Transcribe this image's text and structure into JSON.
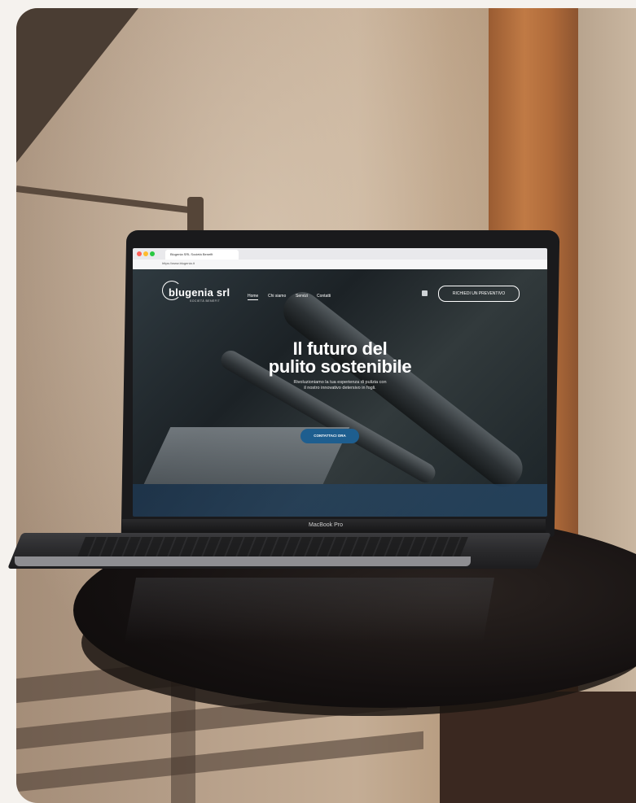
{
  "browser": {
    "tab_title": "Blugenia SRL Società Benefit",
    "url": "https://www.blugenia.it"
  },
  "site": {
    "logo_text": "blugenia srl",
    "logo_subtext": "SOCIETÀ BENEFIT",
    "nav": [
      {
        "label": "Home"
      },
      {
        "label": "Chi siamo"
      },
      {
        "label": "Servizi"
      },
      {
        "label": "Contatti"
      }
    ],
    "cta_top_label": "RICHIEDI UN PREVENTIVO",
    "hero_title_line1": "Il futuro del",
    "hero_title_line2": "pulito sostenibile",
    "hero_sub_line1": "Rivoluzioniamo la tua esperienza di pulizia con",
    "hero_sub_line2": "il nostro innovativo detersivo in fogli.",
    "hero_button_label": "CONTATTACI ORA"
  },
  "device": {
    "label": "MacBook Pro"
  },
  "colors": {
    "accent": "#1e5e8f",
    "table": "#141010",
    "wood": "#b06b3a"
  }
}
